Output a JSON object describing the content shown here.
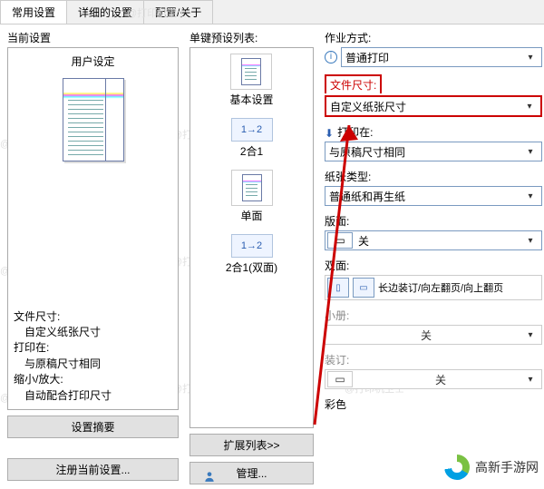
{
  "tabs": [
    "常用设置",
    "详细的设置",
    "配置/关于"
  ],
  "watermark": "@打印机卫士",
  "col1": {
    "section": "当前设置",
    "title": "用户设定",
    "info": {
      "fileSizeLabel": "文件尺寸:",
      "fileSize": "自定义纸张尺寸",
      "printOnLabel": "打印在:",
      "printOn": "与原稿尺寸相同",
      "zoomLabel": "缩小/放大:",
      "zoom": "自动配合打印尺寸"
    },
    "summaryBtn": "设置摘要",
    "registerBtn": "注册当前设置..."
  },
  "col2": {
    "section": "单键预设列表:",
    "items": [
      "基本设置",
      "2合1",
      "单面",
      "2合1(双面)"
    ],
    "expandBtn": "扩展列表>>",
    "manageBtn": "管理..."
  },
  "col3": {
    "jobType": {
      "label": "作业方式:",
      "value": "普通打印"
    },
    "fileSize": {
      "label": "文件尺寸:",
      "value": "自定义纸张尺寸"
    },
    "printOn": {
      "label": "打印在:",
      "value": "与原稿尺寸相同"
    },
    "paperType": {
      "label": "纸张类型:",
      "value": "普通纸和再生纸"
    },
    "layout": {
      "label": "版面:",
      "value": "关"
    },
    "duplex": {
      "label": "双面:",
      "value": "长边装订/向左翻页/向上翻页"
    },
    "booklet": {
      "label": "小册:",
      "value": "关"
    },
    "binding": {
      "label": "装订:",
      "value": "关"
    },
    "color": {
      "label": "彩色"
    }
  },
  "logo": "高新手游网"
}
